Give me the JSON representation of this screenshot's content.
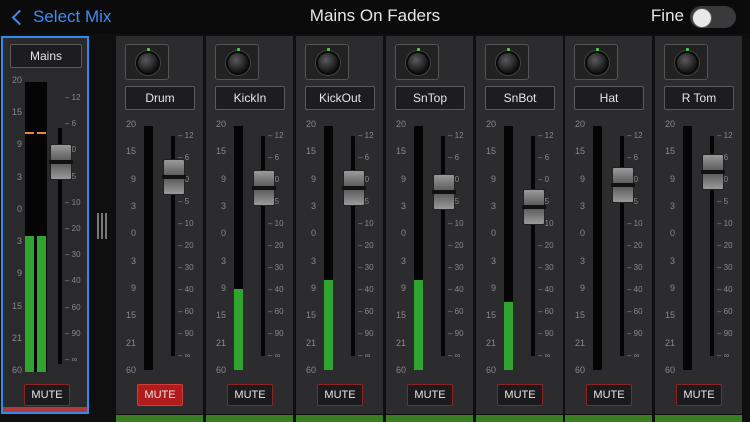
{
  "header": {
    "back_label": "Select Mix",
    "title": "Mains On Faders",
    "fine_label": "Fine",
    "fine_on": false
  },
  "meter_scale": [
    "20",
    "15",
    "9",
    "3",
    "0",
    "3",
    "9",
    "15",
    "21",
    "60"
  ],
  "fader_scale": [
    "12",
    "6",
    "0",
    "5",
    "10",
    "20",
    "30",
    "40",
    "60",
    "90",
    "∞"
  ],
  "mains": {
    "label": "Mains",
    "mute_label": "MUTE",
    "muted": false,
    "meter_level": 0.47,
    "peak": 0.82,
    "fader": 0.86
  },
  "channels": [
    {
      "name": "Drum",
      "mute_label": "MUTE",
      "muted": true,
      "meter_level": 0.0,
      "fader": 0.82
    },
    {
      "name": "KickIn",
      "mute_label": "MUTE",
      "muted": false,
      "meter_level": 0.33,
      "fader": 0.77
    },
    {
      "name": "KickOut",
      "mute_label": "MUTE",
      "muted": false,
      "meter_level": 0.37,
      "fader": 0.77
    },
    {
      "name": "SnTop",
      "mute_label": "MUTE",
      "muted": false,
      "meter_level": 0.37,
      "fader": 0.75
    },
    {
      "name": "SnBot",
      "mute_label": "MUTE",
      "muted": false,
      "meter_level": 0.28,
      "fader": 0.68
    },
    {
      "name": "Hat",
      "mute_label": "MUTE",
      "muted": false,
      "meter_level": 0.0,
      "fader": 0.78
    },
    {
      "name": "R Tom",
      "mute_label": "MUTE",
      "muted": false,
      "meter_level": 0.0,
      "fader": 0.84
    }
  ]
}
